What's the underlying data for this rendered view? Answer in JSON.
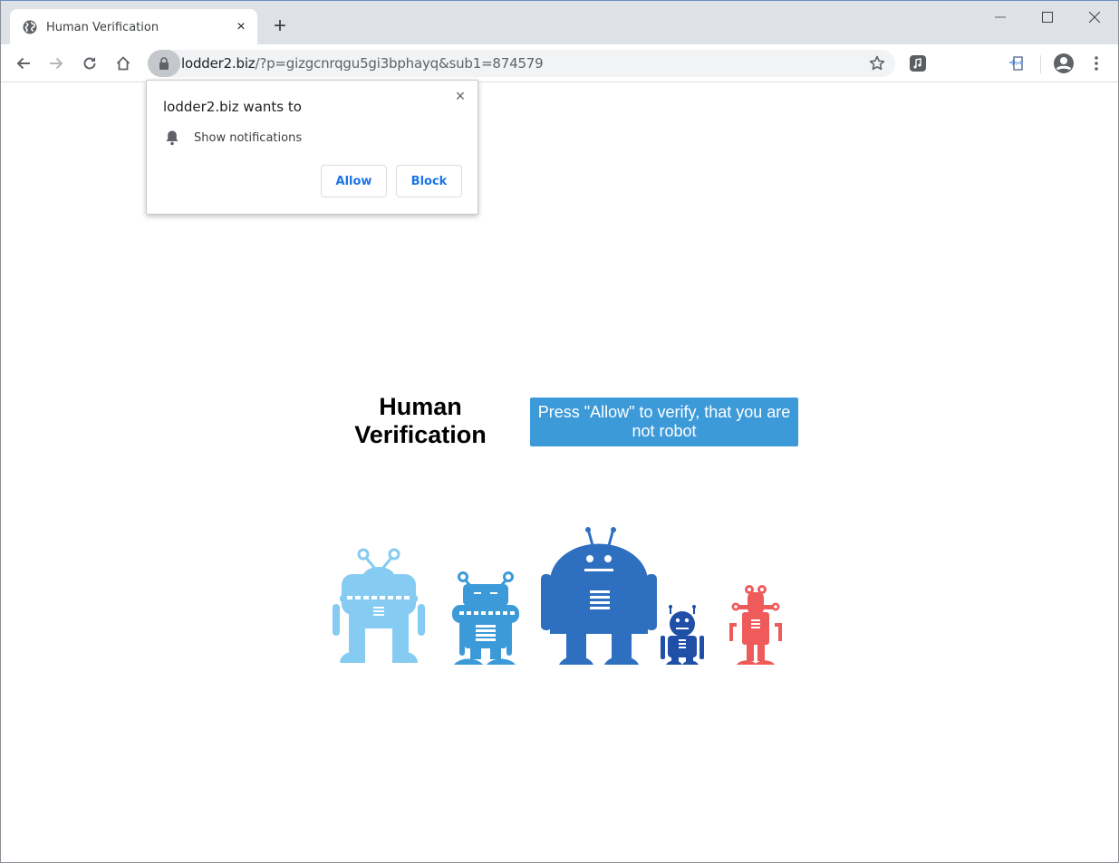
{
  "browser": {
    "tab": {
      "title": "Human Verification",
      "favicon": "globe-icon",
      "close": "×"
    },
    "new_tab": "+",
    "window_controls": {
      "minimize": "minimize-icon",
      "maximize": "maximize-icon",
      "close": "close-icon"
    },
    "nav": {
      "back": "arrow-left-icon",
      "forward": "arrow-right-icon",
      "reload": "reload-icon",
      "home": "home-icon"
    },
    "address_bar": {
      "host": "lodder2.biz",
      "path": "/?p=gizgcnrqgu5gi3bphayq&sub1=874579",
      "lock": "lock-icon",
      "bookmark": "star-icon"
    },
    "extensions": [
      "music-extension-icon",
      "pdf-extension-icon"
    ],
    "profile": "account-circle-icon",
    "menu": "more-vert-icon"
  },
  "permission_popup": {
    "title": "lodder2.biz wants to",
    "permission": "Show notifications",
    "permission_icon": "bell-icon",
    "close": "×",
    "allow_label": "Allow",
    "block_label": "Block"
  },
  "page": {
    "heading_line1": "Human",
    "heading_line2": "Verification",
    "cta_text": "Press \"Allow\" to verify, that you are not robot",
    "robots": [
      {
        "name": "robot-light-blue",
        "color": "#86cbf2"
      },
      {
        "name": "robot-medium-blue",
        "color": "#3c9ad8"
      },
      {
        "name": "robot-large-blue",
        "color": "#2f6fc0"
      },
      {
        "name": "robot-small-navy",
        "color": "#1f4fa6"
      },
      {
        "name": "robot-red",
        "color": "#ef5a5a"
      }
    ]
  },
  "colors": {
    "cta_background": "#3d9ad9",
    "popup_button_text": "#1a73e8",
    "tabstrip": "#dee1e6"
  }
}
